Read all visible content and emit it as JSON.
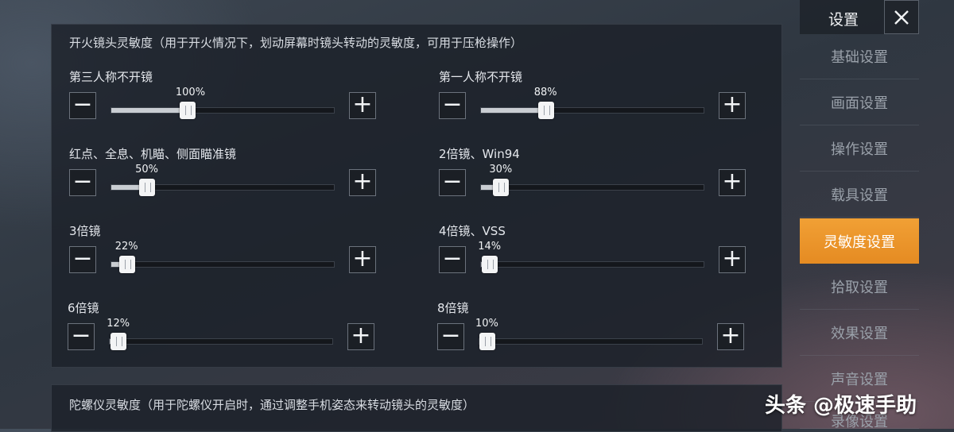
{
  "panel": {
    "heading": "开火镜头灵敏度（用于开火情况下，划动屏幕时镜头转动的灵敏度，可用于压枪操作）",
    "settings": [
      {
        "label": "第三人称不开镜",
        "percent_text": "100%",
        "fraction": 0.34
      },
      {
        "label": "第一人称不开镜",
        "percent_text": "88%",
        "fraction": 0.29
      },
      {
        "label": "红点、全息、机瞄、侧面瞄准镜",
        "percent_text": "50%",
        "fraction": 0.16
      },
      {
        "label": "2倍镜、Win94",
        "percent_text": "30%",
        "fraction": 0.09
      },
      {
        "label": "3倍镜",
        "percent_text": "22%",
        "fraction": 0.07
      },
      {
        "label": "4倍镜、VSS",
        "percent_text": "14%",
        "fraction": 0.04
      },
      {
        "label": "6倍镜",
        "percent_text": "12%",
        "fraction": 0.04
      },
      {
        "label": "8倍镜",
        "percent_text": "10%",
        "fraction": 0.03
      }
    ],
    "minus_symbol": "−",
    "plus_symbol": "+"
  },
  "panel2": {
    "heading": "陀螺仪灵敏度（用于陀螺仪开启时，通过调整手机姿态来转动镜头的灵敏度）"
  },
  "sidebar": {
    "title": "设置",
    "items": [
      {
        "label": "基础设置",
        "active": false
      },
      {
        "label": "画面设置",
        "active": false
      },
      {
        "label": "操作设置",
        "active": false
      },
      {
        "label": "载具设置",
        "active": false
      },
      {
        "label": "灵敏度设置",
        "active": true
      },
      {
        "label": "拾取设置",
        "active": false
      },
      {
        "label": "效果设置",
        "active": false
      },
      {
        "label": "声音设置",
        "active": false
      },
      {
        "label": "录像设置",
        "active": false
      }
    ]
  },
  "watermark": "头条 @极速手助",
  "colors": {
    "accent": "#e58b22",
    "panel": "#1c2129"
  },
  "icons": {
    "close": "close-icon",
    "minus": "minus-icon",
    "plus": "plus-icon"
  }
}
